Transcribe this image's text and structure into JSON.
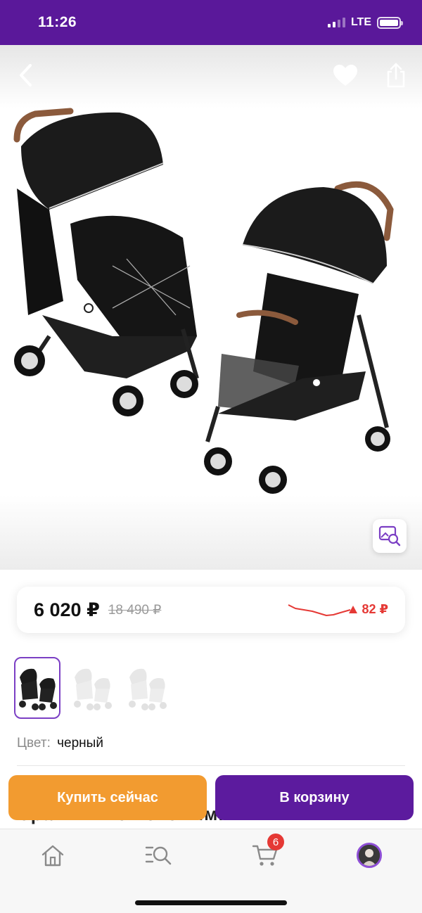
{
  "status_bar": {
    "time": "11:26",
    "network": "LTE"
  },
  "product": {
    "price_current": "6 020 ₽",
    "price_old": "18 490 ₽",
    "price_change": "82 ₽",
    "price_change_direction": "up",
    "color_label": "Цвет:",
    "color_value": "черный",
    "peek_text": "Сравнить с похожими"
  },
  "thumbnails": [
    {
      "name": "thumb-1",
      "active": true
    },
    {
      "name": "thumb-2",
      "active": false
    },
    {
      "name": "thumb-3",
      "active": false
    }
  ],
  "actions": {
    "buy_now": "Купить сейчас",
    "add_to_cart": "В корзину"
  },
  "bottom_nav": {
    "items": [
      {
        "name": "home",
        "icon": "home-icon"
      },
      {
        "name": "catalog",
        "icon": "search-list-icon"
      },
      {
        "name": "cart",
        "icon": "cart-icon",
        "badge": "6"
      },
      {
        "name": "profile",
        "icon": "avatar"
      }
    ]
  },
  "colors": {
    "brand_purple": "#5c1b9e",
    "buy_orange": "#f29b30",
    "alert_red": "#e53935",
    "status_bar": "#5a189a"
  }
}
